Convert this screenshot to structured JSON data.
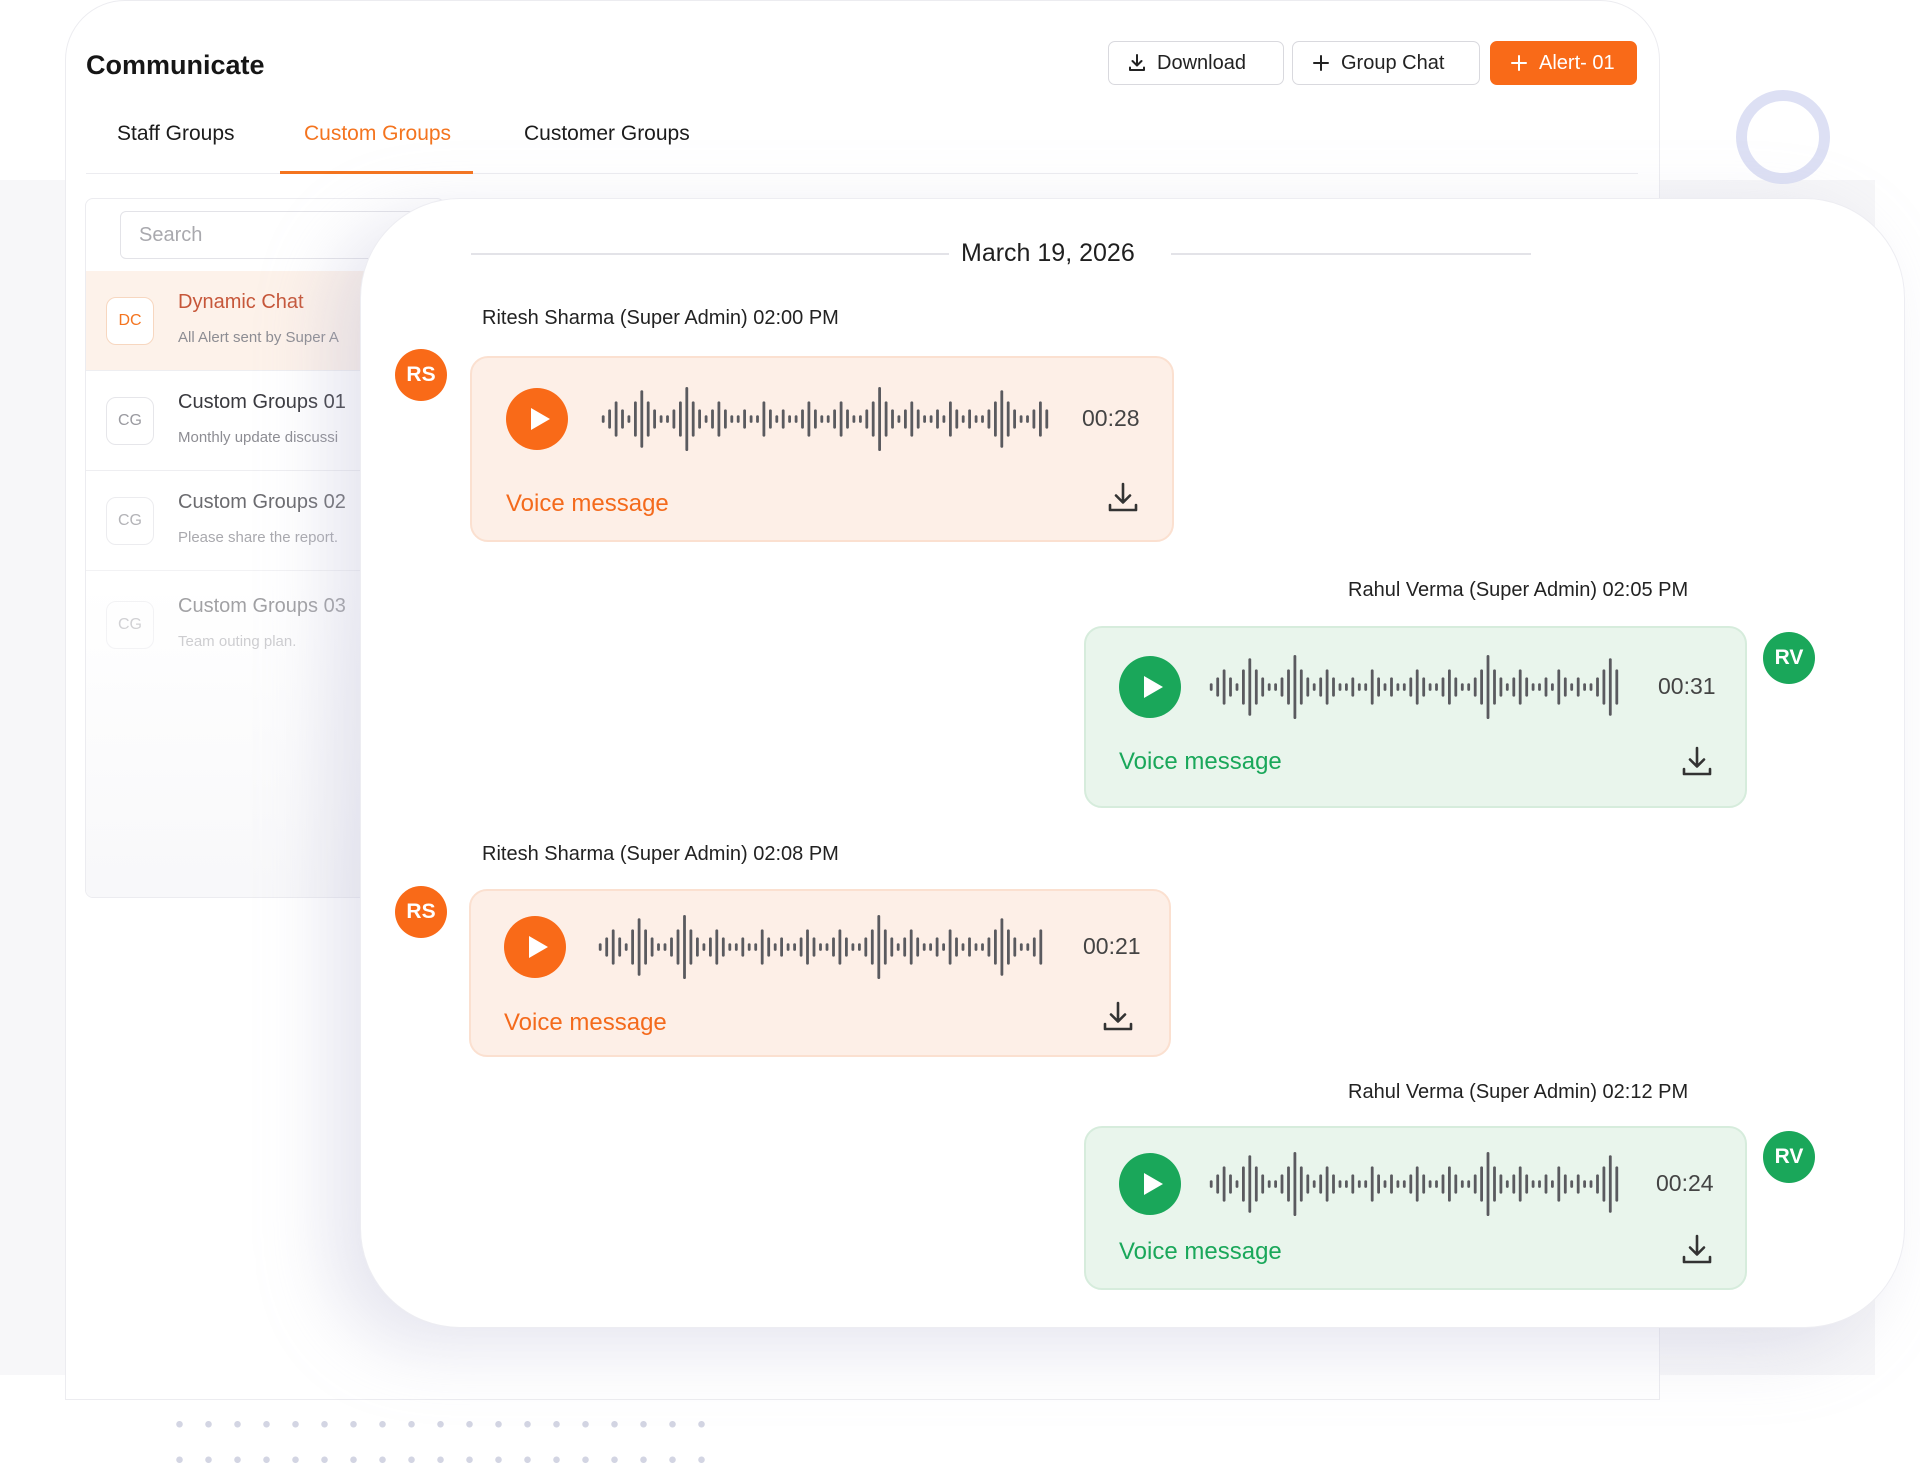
{
  "app": {
    "title": "Communicate",
    "buttons": {
      "download": "Download",
      "group_chat": "Group Chat",
      "alert": "Alert- 01"
    },
    "tabs": [
      {
        "label": "Staff Groups",
        "active": false
      },
      {
        "label": "Custom Groups",
        "active": true
      },
      {
        "label": "Customer Groups",
        "active": false
      }
    ]
  },
  "sidebar": {
    "search_placeholder": "Search",
    "items": [
      {
        "initials": "DC",
        "title": "Dynamic Chat",
        "subtitle": "All Alert sent by Super A",
        "active": true
      },
      {
        "initials": "CG",
        "title": "Custom Groups 01",
        "subtitle": "Monthly update discussi",
        "active": false
      },
      {
        "initials": "CG",
        "title": "Custom Groups 02",
        "subtitle": "Please share the report.",
        "active": false
      },
      {
        "initials": "CG",
        "title": "Custom Groups 03",
        "subtitle": "Team outing plan.",
        "active": false
      }
    ]
  },
  "chat": {
    "date": "March 19, 2026",
    "messages": [
      {
        "sender": "Ritesh Sharma (Super Admin) 02:00 PM",
        "initials": "RS",
        "side": "left",
        "duration": "00:28",
        "label": "Voice message"
      },
      {
        "sender": "Rahul Verma (Super Admin) 02:05 PM",
        "initials": "RV",
        "side": "right",
        "duration": "00:31",
        "label": "Voice message"
      },
      {
        "sender": "Ritesh Sharma (Super Admin) 02:08 PM",
        "initials": "RS",
        "side": "left",
        "duration": "00:21",
        "label": "Voice message"
      },
      {
        "sender": "Rahul Verma (Super Admin)  02:12 PM",
        "initials": "RV",
        "side": "right",
        "duration": "00:24",
        "label": "Voice message"
      }
    ]
  },
  "colors": {
    "accent_orange": "#f96a18",
    "accent_green": "#1aa75a",
    "orange_bubble": "#fdefe7",
    "green_bubble": "#e9f5ec"
  },
  "icons": {
    "download": "download-icon",
    "plus": "plus-icon",
    "play": "play-icon"
  }
}
